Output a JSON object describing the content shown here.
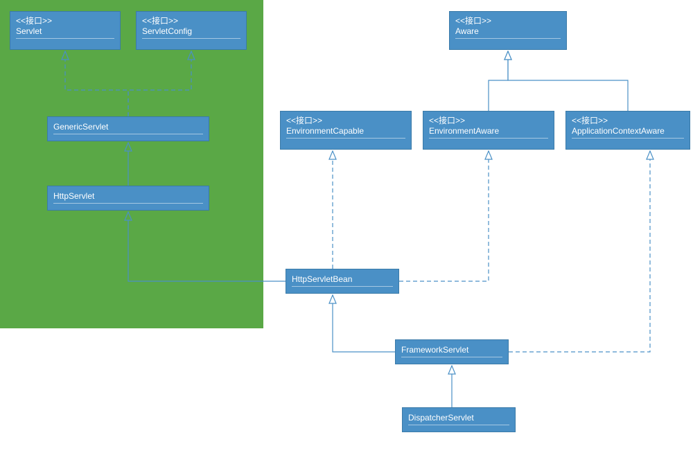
{
  "diagram": {
    "stereotypeLabel": "<<接口>>",
    "boxes": {
      "servlet": {
        "stereo": true,
        "name": "Servlet"
      },
      "servletConfig": {
        "stereo": true,
        "name": "ServletConfig"
      },
      "genericServlet": {
        "stereo": false,
        "name": "GenericServlet"
      },
      "httpServlet": {
        "stereo": false,
        "name": "HttpServlet"
      },
      "aware": {
        "stereo": true,
        "name": "Aware"
      },
      "environmentCapable": {
        "stereo": true,
        "name": "EnvironmentCapable"
      },
      "environmentAware": {
        "stereo": true,
        "name": "EnvironmentAware"
      },
      "appContextAware": {
        "stereo": true,
        "name": "ApplicationContextAware"
      },
      "httpServletBean": {
        "stereo": false,
        "name": "HttpServletBean"
      },
      "frameworkServlet": {
        "stereo": false,
        "name": "FrameworkServlet"
      },
      "dispatcherServlet": {
        "stereo": false,
        "name": "DispatcherServlet"
      }
    },
    "colors": {
      "box": "#4a90c6",
      "boxBorder": "#3a7aa8",
      "line": "#4a90c6",
      "greenBg": "#5aa846"
    }
  }
}
